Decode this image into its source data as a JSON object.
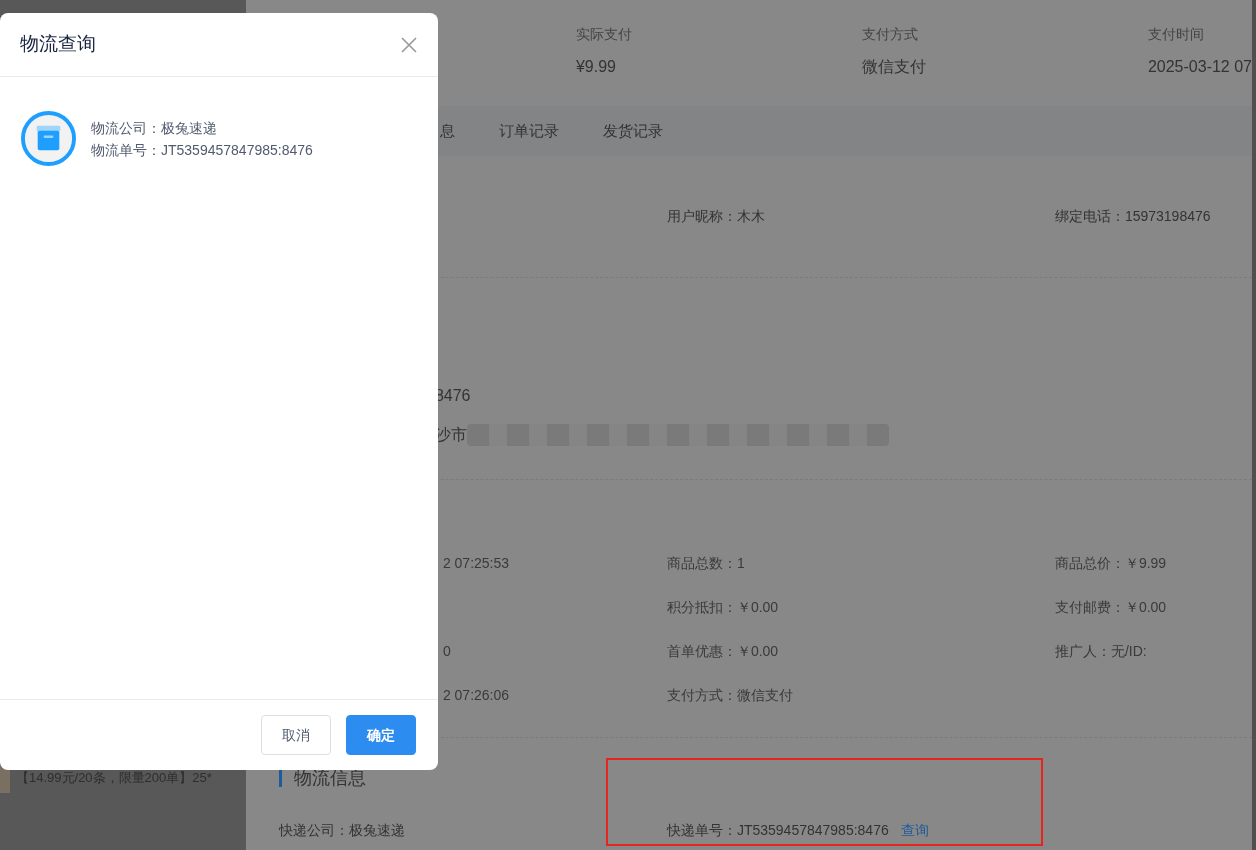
{
  "left_panel": {
    "item_text": "【14.99元/20条，限量200单】25*"
  },
  "summary": [
    {
      "label": "实际支付",
      "value": "¥9.99"
    },
    {
      "label": "支付方式",
      "value": "微信支付"
    },
    {
      "label": "支付时间",
      "value": "2025-03-12 07"
    }
  ],
  "tabs": [
    {
      "label": "息"
    },
    {
      "label": "订单记录"
    },
    {
      "label": "发货记录"
    }
  ],
  "user_info": {
    "nickname": "用户昵称：木木",
    "phone": "绑定电话：15973198476"
  },
  "address": {
    "phone_fragment": "8476",
    "address_fragment": "沙市"
  },
  "order_rows": [
    {
      "col1": "2 07:25:53",
      "col2": "商品总数：1",
      "col3": "商品总价：￥9.99"
    },
    {
      "col2": "积分抵扣：￥0.00",
      "col3": "支付邮费：￥0.00"
    },
    {
      "col1": "0",
      "col2": "首单优惠：￥0.00",
      "col3": "推广人：无/ID:"
    },
    {
      "col1": "2 07:26:06",
      "col2": "支付方式：微信支付"
    }
  ],
  "logistics": {
    "title": "物流信息",
    "company": "快递公司：极兔速递",
    "tracking": "快递单号：JT5359457847985:8476",
    "query_link": "查询"
  },
  "dialog": {
    "title": "物流查询",
    "company": "物流公司：极兔速递",
    "tracking_no": "物流单号：JT5359457847985:8476",
    "buttons": [
      {
        "label": "取消",
        "kind": "default"
      },
      {
        "label": "确定",
        "kind": "primary"
      }
    ]
  }
}
